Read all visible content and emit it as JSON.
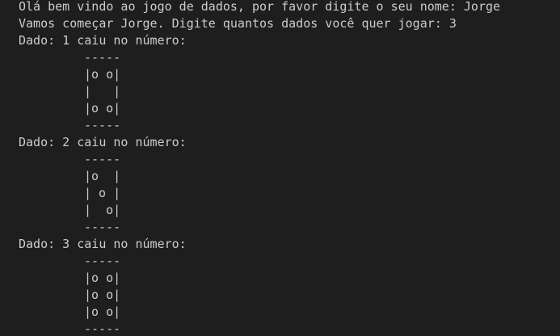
{
  "terminal": {
    "lines": [
      "Olá bem vindo ao jogo de dados, por favor digite o seu nome: Jorge",
      "Vamos começar Jorge. Digite quantos dados você quer jogar: 3"
    ],
    "dice": [
      {
        "header": "Dado: 1 caiu no número:",
        "art": [
          "-----",
          "|o o|",
          "|   |",
          "|o o|",
          "-----"
        ]
      },
      {
        "header": "Dado: 2 caiu no número:",
        "art": [
          "-----",
          "|o  |",
          "| o |",
          "|  o|",
          "-----"
        ]
      },
      {
        "header": "Dado: 3 caiu no número:",
        "art": [
          "-----",
          "|o o|",
          "|o o|",
          "|o o|",
          "-----"
        ]
      }
    ]
  }
}
